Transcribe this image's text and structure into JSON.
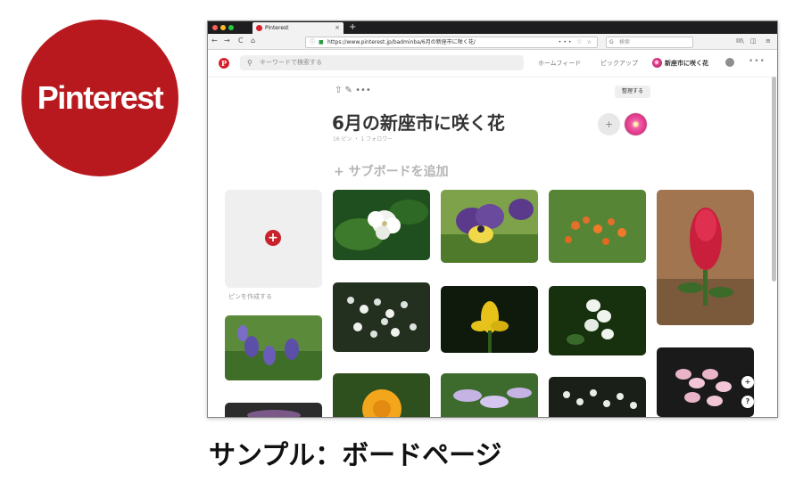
{
  "logo": {
    "text": "Pinterest",
    "color": "#b8191e"
  },
  "caption": "サンプル：ボードページ",
  "browser": {
    "tab_title": "Pinterest",
    "tab_close": "×",
    "new_tab": "+",
    "nav": {
      "back": "←",
      "forward": "→",
      "reload": "C",
      "home": "⌂"
    },
    "url": "https://www.pinterest.jp/badminba/6月の新座市に咲く花/",
    "url_actions": "••• ♡ ☆",
    "search_placeholder": "検索",
    "library_icon": "III\\",
    "sidebar_icon": "◫",
    "menu_icon": "≡"
  },
  "pinterest": {
    "logo_letter": "P",
    "search_placeholder": "キーワードで検索する",
    "nav_home_feed": "ホームフィード",
    "nav_pickup": "ピックアップ",
    "nav_board": "新座市に咲く花",
    "more": "•••"
  },
  "board": {
    "tools": "⇧  ✎  •••",
    "organize": "整理する",
    "title": "6月の新座市に咲く花",
    "meta": "16 ピン ・ 1 フォロワー",
    "add_subboard": "+ サブボードを追加",
    "create_pin_label": "ピンを作成する",
    "create_pin_plus": "+",
    "accent": "#c8232c"
  },
  "floating": {
    "plus": "+",
    "help": "?"
  },
  "pins": [
    {
      "name": "pin-white-trillium",
      "colors": [
        "#1f4f1e",
        "#3e7a2c"
      ]
    },
    {
      "name": "pin-pansy",
      "colors": [
        "#5b3a8c",
        "#7ea24a"
      ]
    },
    {
      "name": "pin-orange-flowers",
      "colors": [
        "#4b7a2e",
        "#e0702a"
      ]
    },
    {
      "name": "pin-red-clover",
      "colors": [
        "#a07550",
        "#c91f3d"
      ]
    },
    {
      "name": "pin-white-clusters",
      "colors": [
        "#24301f",
        "#dde2de"
      ]
    },
    {
      "name": "pin-yellow-iris",
      "colors": [
        "#0f1a0c",
        "#e6c21a"
      ]
    },
    {
      "name": "pin-white-bells",
      "colors": [
        "#17310f",
        "#f0f4ee"
      ]
    },
    {
      "name": "pin-pink-lilies",
      "colors": [
        "#1a1a1a",
        "#e9b4c8"
      ]
    },
    {
      "name": "pin-blue-vetch",
      "colors": [
        "#5b8a3a",
        "#5c4fa8"
      ]
    },
    {
      "name": "pin-calendula",
      "colors": [
        "#2e4f1e",
        "#f3a51c"
      ]
    },
    {
      "name": "pin-hosta",
      "colors": [
        "#3d6b2e",
        "#c4b3e3"
      ]
    },
    {
      "name": "pin-white-small-bells",
      "colors": [
        "#1a1f18",
        "#e8ede8"
      ]
    },
    {
      "name": "pin-bottom-left",
      "colors": [
        "#2c2c2c",
        "#7b5a8a"
      ]
    }
  ]
}
